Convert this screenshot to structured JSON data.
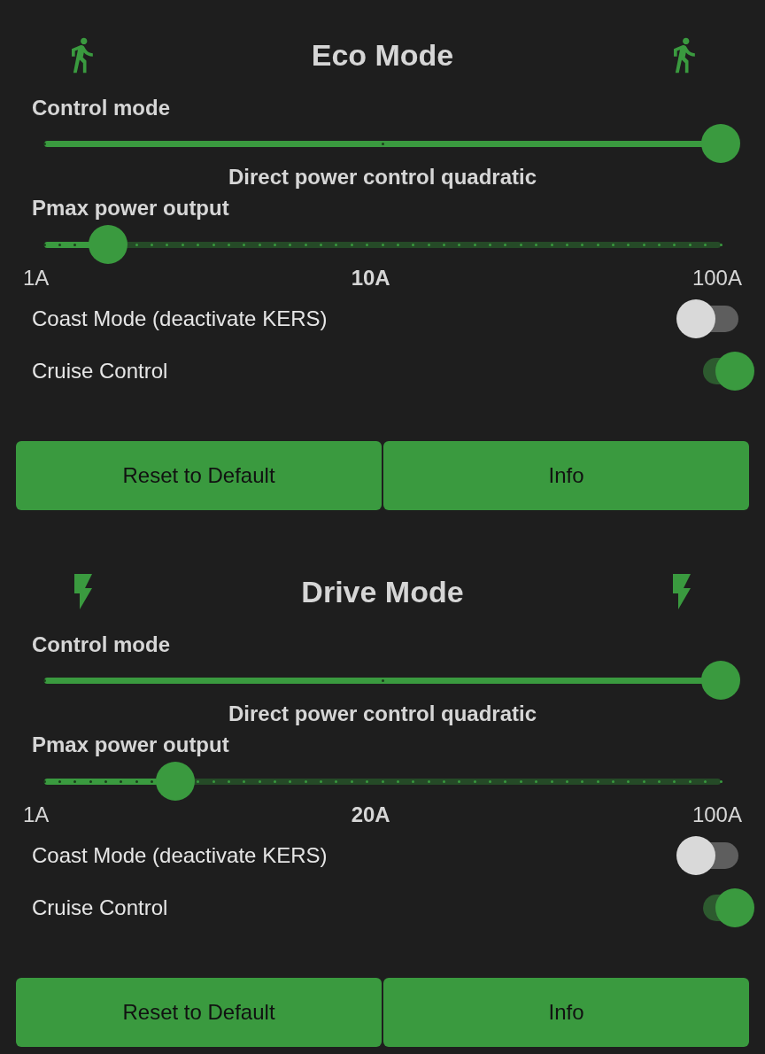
{
  "sections": [
    {
      "title": "Eco Mode",
      "kind": "walk",
      "control_mode": {
        "label": "Control mode",
        "level": 1,
        "value": "Direct power control quadratic"
      },
      "pmax": {
        "label": "Pmax power output",
        "level": 0.094,
        "min": "1A",
        "current": "10A",
        "max": "100A"
      },
      "toggles": [
        {
          "label": "Coast Mode (deactivate KERS)",
          "on": false
        },
        {
          "label": "Cruise Control",
          "on": true
        }
      ],
      "buttons": [
        "Reset to Default",
        "Info"
      ]
    },
    {
      "title": "Drive Mode",
      "kind": "bolt",
      "control_mode": {
        "label": "Control mode",
        "level": 1,
        "value": "Direct power control quadratic"
      },
      "pmax": {
        "label": "Pmax power output",
        "level": 0.194,
        "min": "1A",
        "current": "20A",
        "max": "100A"
      },
      "toggles": [
        {
          "label": "Coast Mode (deactivate KERS)",
          "on": false
        },
        {
          "label": "Cruise Control",
          "on": true
        }
      ],
      "buttons": [
        "Reset to Default",
        "Info"
      ]
    }
  ]
}
